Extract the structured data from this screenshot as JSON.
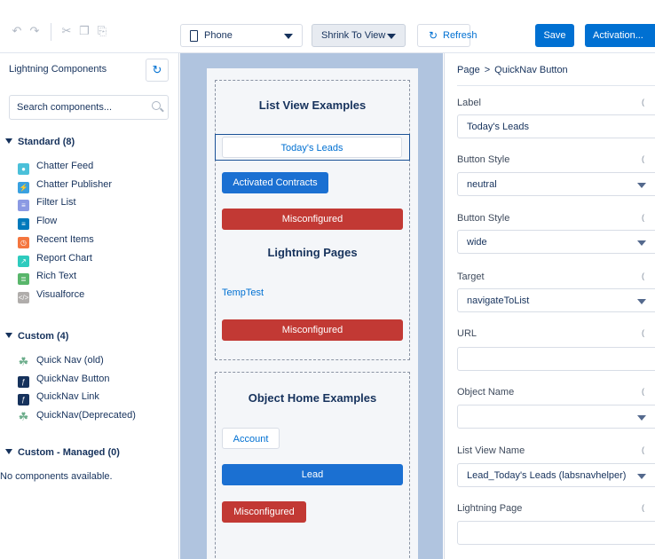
{
  "toolbar": {
    "device": "Phone",
    "view_mode": "Shrink To View",
    "refresh_label": "Refresh",
    "save_label": "Save",
    "activation_label": "Activation..."
  },
  "palette": {
    "title": "Lightning Components",
    "search_placeholder": "Search components...",
    "standard_header": "Standard (8)",
    "standard_items": [
      {
        "label": "Chatter Feed",
        "icon": "chatter-feed-icon",
        "color": "#4bc0d9"
      },
      {
        "label": "Chatter Publisher",
        "icon": "chatter-publisher-icon",
        "color": "#3aa1e0"
      },
      {
        "label": "Filter List",
        "icon": "filter-list-icon",
        "color": "#8b9ae3"
      },
      {
        "label": "Flow",
        "icon": "flow-icon",
        "color": "#0079bc"
      },
      {
        "label": "Recent Items",
        "icon": "recent-items-icon",
        "color": "#f4763f"
      },
      {
        "label": "Report Chart",
        "icon": "report-chart-icon",
        "color": "#2ecbbe"
      },
      {
        "label": "Rich Text",
        "icon": "rich-text-icon",
        "color": "#59b66b"
      },
      {
        "label": "Visualforce",
        "icon": "visualforce-icon",
        "color": "#b0adab"
      }
    ],
    "custom_header": "Custom (4)",
    "custom_items": [
      {
        "label": "Quick Nav (old)",
        "icon": "puzzle-icon",
        "color": "#6cad8b"
      },
      {
        "label": "QuickNav Button",
        "icon": "lightning-bolt-icon",
        "color": "#16325c"
      },
      {
        "label": "QuickNav Link",
        "icon": "lightning-bolt-icon",
        "color": "#16325c"
      },
      {
        "label": "QuickNav(Deprecated)",
        "icon": "puzzle-icon",
        "color": "#6cad8b"
      }
    ],
    "managed_header": "Custom - Managed (0)",
    "managed_empty": "No components available."
  },
  "canvas": {
    "section1_title": "List View Examples",
    "btn_todays_leads": "Today's Leads",
    "btn_activated_contracts": "Activated Contracts",
    "btn_misconfigured_1": "Misconfigured",
    "section2_title": "Lightning Pages",
    "link_temptest": "TempTest",
    "btn_misconfigured_2": "Misconfigured",
    "section3_title": "Object Home Examples",
    "btn_account": "Account",
    "btn_lead": "Lead",
    "btn_misconfigured_3": "Misconfigured"
  },
  "properties": {
    "breadcrumb_root": "Page",
    "breadcrumb_sep": ">",
    "breadcrumb_current": "QuickNav Button",
    "label_label": "Label",
    "label_value": "Today's Leads",
    "button_style_label_1": "Button Style",
    "button_style_value_1": "neutral",
    "button_style_label_2": "Button Style",
    "button_style_value_2": "wide",
    "target_label": "Target",
    "target_value": "navigateToList",
    "url_label": "URL",
    "url_value": "",
    "object_name_label": "Object Name",
    "object_name_value": "",
    "list_view_label": "List View Name",
    "list_view_value": "Lead_Today's Leads (labsnavhelper)",
    "lightning_page_label": "Lightning Page",
    "lightning_page_value": ""
  }
}
